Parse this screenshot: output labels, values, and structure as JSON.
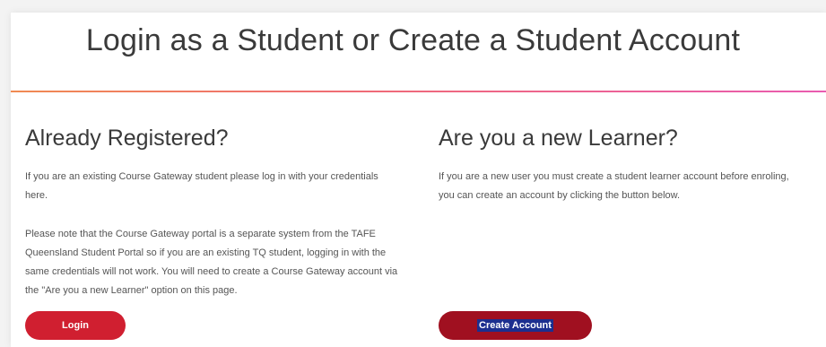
{
  "page": {
    "title": "Login as a Student or Create a Student Account"
  },
  "registered": {
    "heading": "Already Registered?",
    "para1": "If you are an existing Course Gateway student please log in with your credentials here.",
    "para2": "Please note that the Course Gateway portal is a separate system from the TAFE Queensland Student Portal so if you are an existing TQ student, logging in with the same credentials will not work. You will need to create a Course Gateway account via the \"Are you a new Learner\" option on this page.",
    "button_label": "Login"
  },
  "new_learner": {
    "heading": "Are you a new Learner?",
    "para1": "If you are a new user you must create a student learner account before enroling, you can create an account by clicking the button below.",
    "button_label": "Create Account"
  },
  "colors": {
    "login_button": "#d01f30",
    "create_button": "#a01020",
    "divider_start": "#f08a52",
    "divider_end": "#e95bb0",
    "text_selection": "#1c2f8f"
  }
}
